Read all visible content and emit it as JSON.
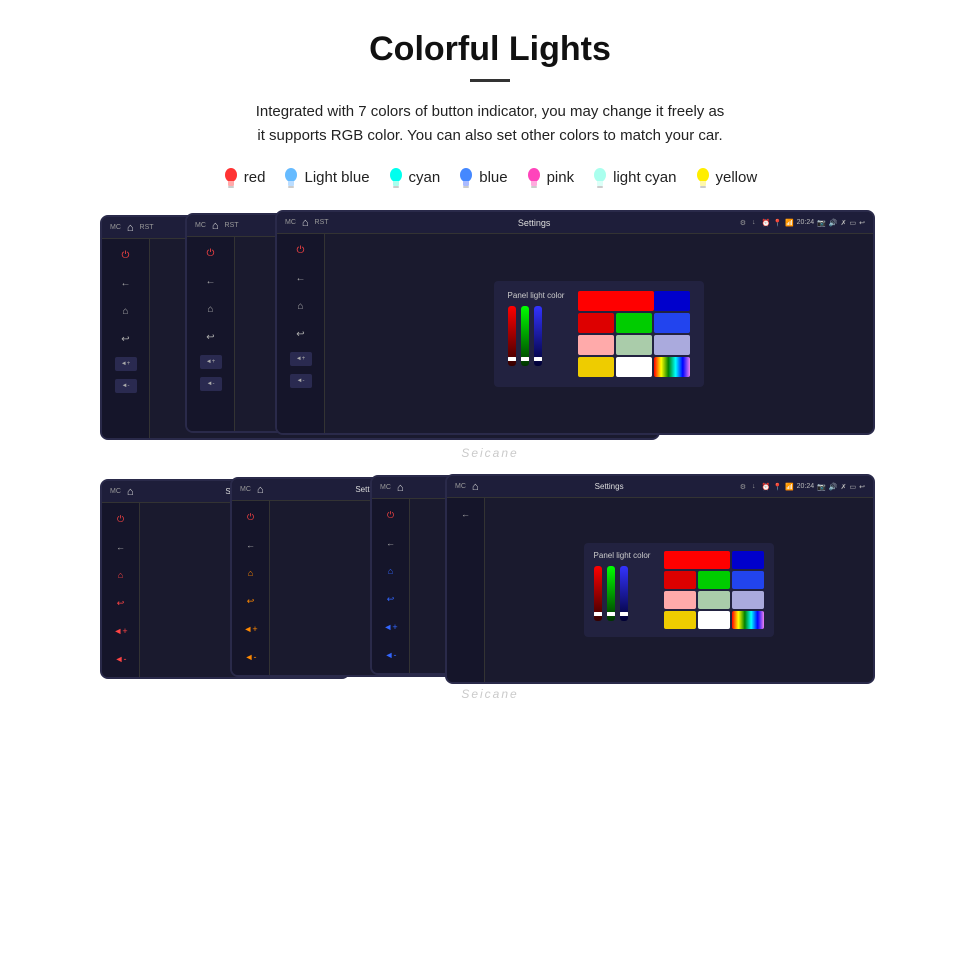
{
  "page": {
    "title": "Colorful Lights",
    "description": "Integrated with 7 colors of button indicator, you may change it freely as\nit supports RGB color. You can also set other colors to match your car.",
    "colors": [
      {
        "name": "red",
        "color": "#ff3333",
        "icon": "💡"
      },
      {
        "name": "Light blue",
        "color": "#66bbff",
        "icon": "💡"
      },
      {
        "name": "cyan",
        "color": "#00ffee",
        "icon": "💡"
      },
      {
        "name": "blue",
        "color": "#4488ff",
        "icon": "💡"
      },
      {
        "name": "pink",
        "color": "#ff44bb",
        "icon": "💡"
      },
      {
        "name": "light cyan",
        "color": "#aaffee",
        "icon": "💡"
      },
      {
        "name": "yellow",
        "color": "#ffee00",
        "icon": "💡"
      }
    ],
    "settings_label": "Panel light color",
    "watermark": "Seicane",
    "header_title": "Settings",
    "header_time": "20:24",
    "color_grid_top": [
      "#ff0000",
      "#00aa00",
      "#0000ff",
      "#ff3333",
      "#00cc44",
      "#5555ff",
      "#ffaaaa",
      "#aaccaa",
      "#aaaaee",
      "#ffee00",
      "#ffffff",
      "#rainbow"
    ]
  }
}
